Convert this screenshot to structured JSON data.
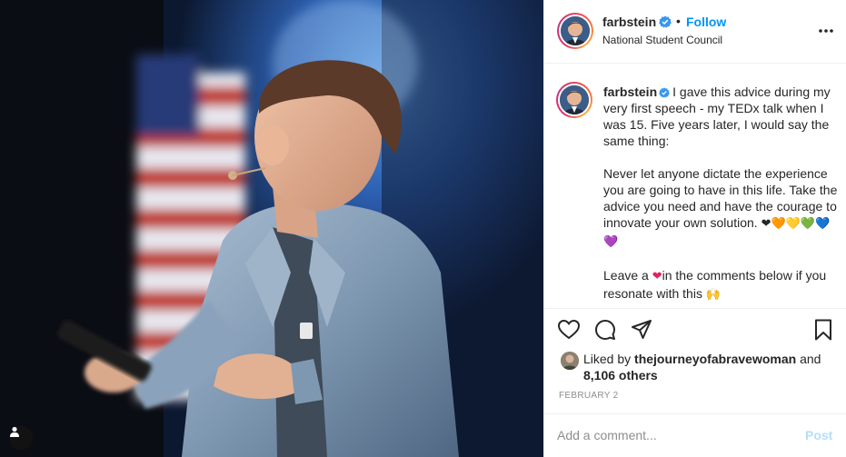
{
  "photo": {
    "tag_icon": "user-tag-icon"
  },
  "header": {
    "username": "farbstein",
    "verified_icon": "verified-badge-icon",
    "separator": "•",
    "follow_label": "Follow",
    "subtitle": "National Student Council",
    "more_icon": "more-options-icon"
  },
  "caption": {
    "username": "farbstein",
    "paragraphs": [
      "I gave this advice during my very first speech - my TEDx talk when I was 15. Five years later, I would say the same thing:",
      "Never let anyone dictate the experience you are going to have in this life. Take the advice you need and have the courage to innovate your own solution.",
      "Leave a",
      "in the comments below if you resonate with this"
    ],
    "emoji_hearts": "❤🧡💛💚💙💜",
    "emoji_heart": "❤",
    "emoji_hands": "🙌"
  },
  "actions": {
    "like_icon": "heart-icon",
    "comment_icon": "comment-icon",
    "share_icon": "share-icon",
    "save_icon": "bookmark-icon"
  },
  "likes": {
    "prefix": "Liked by",
    "user": "thejourneyofabravewoman",
    "conjunction": "and",
    "others": "8,106 others"
  },
  "date": "FEBRUARY 2",
  "comment": {
    "placeholder": "Add a comment...",
    "post_label": "Post"
  },
  "colors": {
    "accent": "#0095f6",
    "post_disabled": "#b2dffc",
    "muted": "#8e8e8e",
    "text": "#262626",
    "verified": "#3897f0"
  }
}
